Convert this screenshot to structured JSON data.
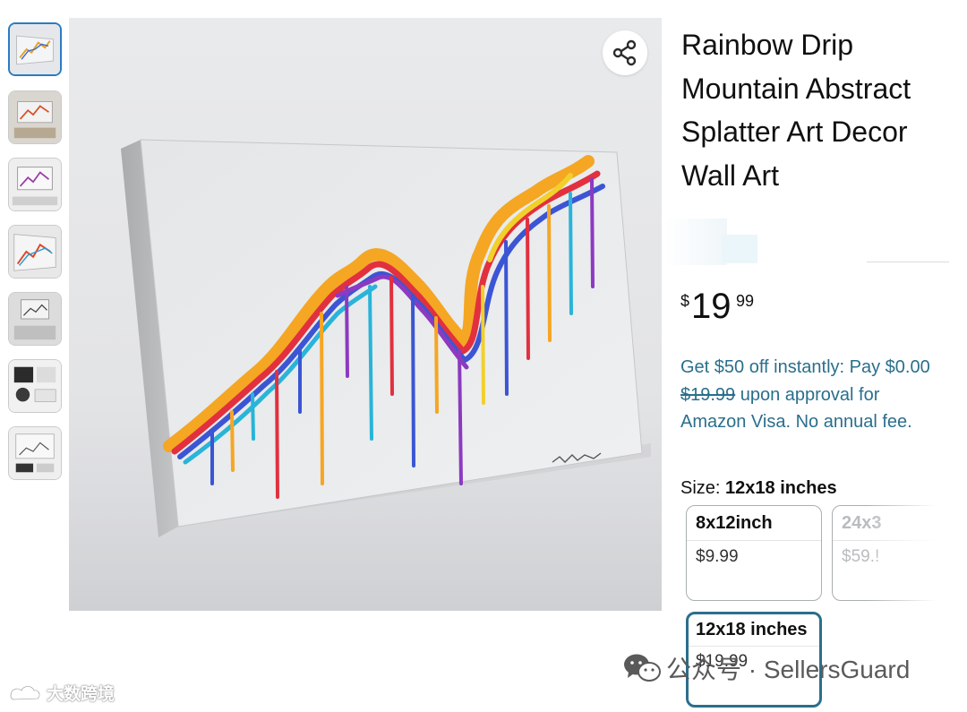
{
  "thumbnails": [
    {
      "label": "thumbnail 1",
      "selected": true
    },
    {
      "label": "thumbnail 2",
      "selected": false
    },
    {
      "label": "thumbnail 3",
      "selected": false
    },
    {
      "label": "thumbnail 4",
      "selected": false
    },
    {
      "label": "thumbnail 5",
      "selected": false
    },
    {
      "label": "thumbnail 6",
      "selected": false
    },
    {
      "label": "thumbnail 7",
      "selected": false
    }
  ],
  "product": {
    "title": "Rainbow Drip Mountain Abstract Splatter Art Decor Wall Art",
    "price": {
      "currency": "$",
      "whole": "19",
      "fraction": "99"
    },
    "promo": {
      "part1": "Get $50 off instantly: Pay $0.00 ",
      "strike": "$19.99",
      "part2": " upon approval for Amazon Visa. No annual fee."
    },
    "size": {
      "label": "Size: ",
      "selected": "12x18 inches",
      "options": [
        {
          "name": "8x12inch",
          "price": "$9.99"
        },
        {
          "name": "24x3",
          "price": "$59.!"
        },
        {
          "name": "12x18 inches",
          "price": "$19.99"
        }
      ]
    }
  },
  "watermarks": {
    "wechat": "公众号 · SellersGuard",
    "corner": "大数跨境"
  },
  "colors": {
    "promo_link": "#2a6f8c",
    "selected_border": "#2a6f8c",
    "thumbnail_selected": "#2a7cc4"
  },
  "icons": {
    "share": "share-icon",
    "wechat": "wechat-icon",
    "brand": "brand-logo-icon"
  }
}
